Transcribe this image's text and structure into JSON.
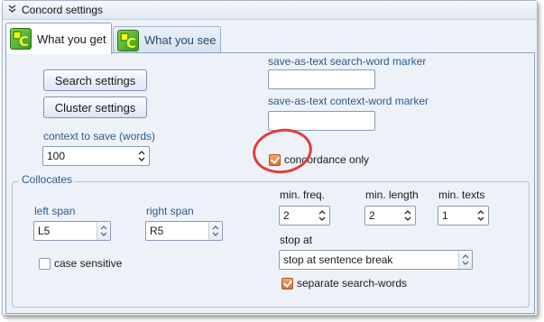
{
  "window": {
    "title": "Concord settings"
  },
  "tabs": [
    {
      "label": "What you get",
      "active": true
    },
    {
      "label": "What you see",
      "active": false
    }
  ],
  "buttons": {
    "search_settings": "Search settings",
    "cluster_settings": "Cluster settings"
  },
  "context": {
    "label": "context to save (words)",
    "value": "100"
  },
  "markers": {
    "search_word_label": "save-as-text search-word marker",
    "search_word_value": "",
    "context_word_label": "save-as-text context-word marker",
    "context_word_value": ""
  },
  "concordance_only": {
    "label": "concordance only",
    "checked": true
  },
  "collocates": {
    "title": "Collocates",
    "left_span": {
      "label": "left span",
      "value": "L5"
    },
    "right_span": {
      "label": "right span",
      "value": "R5"
    },
    "min_freq": {
      "label": "min. freq.",
      "value": "2"
    },
    "min_length": {
      "label": "min. length",
      "value": "2"
    },
    "min_texts": {
      "label": "min. texts",
      "value": "1"
    },
    "stop_at": {
      "label": "stop at",
      "value": "stop at sentence break"
    },
    "case_sensitive": {
      "label": "case sensitive",
      "checked": false
    },
    "separate_search_words": {
      "label": "separate search-words",
      "checked": true
    }
  },
  "colors": {
    "accent": "#e0702c",
    "highlight_circle": "#e23b3b",
    "label_blue": "#2b5a8c"
  }
}
